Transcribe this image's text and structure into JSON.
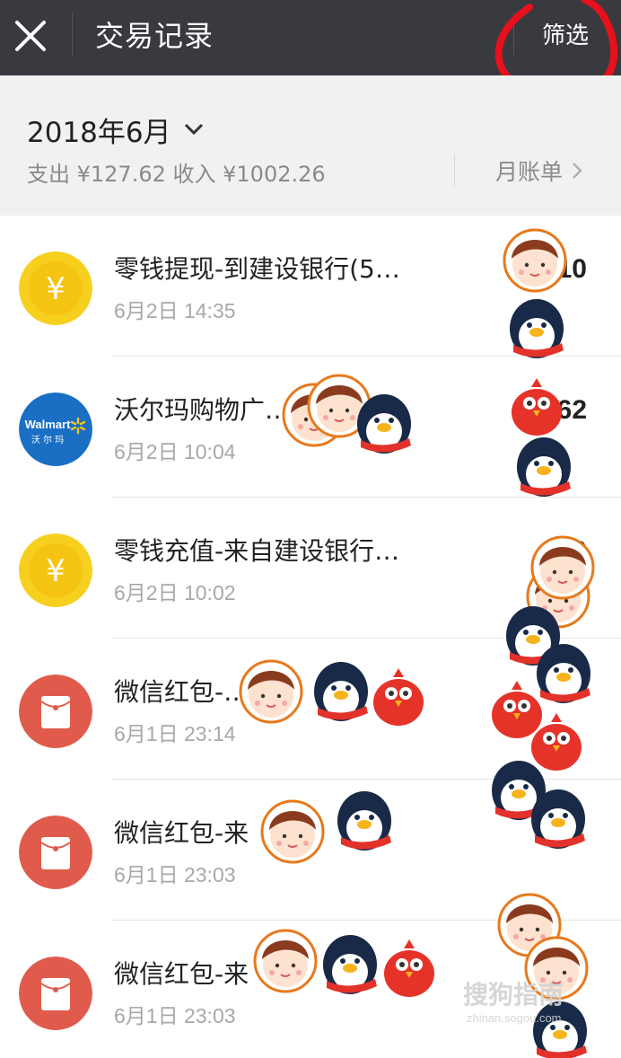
{
  "header": {
    "title": "交易记录",
    "filter_label": "筛选",
    "background": "#393a3f"
  },
  "summary": {
    "month": "2018年6月",
    "totals_text": "支出 ¥127.62 收入 ¥1002.26",
    "bill_link": "月账单"
  },
  "transactions": [
    {
      "icon": "coin-icon",
      "name": "零钱提现-到建设银行(5…",
      "time": "6月2日 14:35",
      "amount": "10",
      "plus": false
    },
    {
      "icon": "walmart-logo",
      "name": "沃尔玛购物广…",
      "time": "6月2日 10:04",
      "amount": "-62",
      "plus": false
    },
    {
      "icon": "coin-icon",
      "name": "零钱充值-来自建设银行…",
      "time": "6月2日 10:02",
      "amount": "10",
      "plus": false
    },
    {
      "icon": "red-packet-icon",
      "name": "微信红包-…",
      "time": "6月1日 23:14",
      "amount": "",
      "plus": false
    },
    {
      "icon": "red-packet-icon",
      "name": "微信红包-来",
      "time": "6月1日 23:03",
      "amount": "",
      "plus": false
    },
    {
      "icon": "red-packet-icon",
      "name": "微信红包-来",
      "time": "6月1日 23:03",
      "amount": "+",
      "plus": true
    }
  ],
  "walmart_logo_text": {
    "en": "Walmart",
    "cn": "沃 尔 玛"
  },
  "watermark": {
    "main": "搜狗指南",
    "sub": "zhinan.sogou.com"
  },
  "colors": {
    "coin": "#f7cf1e",
    "walmart": "#1a6fc4",
    "red_packet": "#e05b4b",
    "plus_amount": "#f3a12f",
    "scribble": "#e8101c"
  }
}
